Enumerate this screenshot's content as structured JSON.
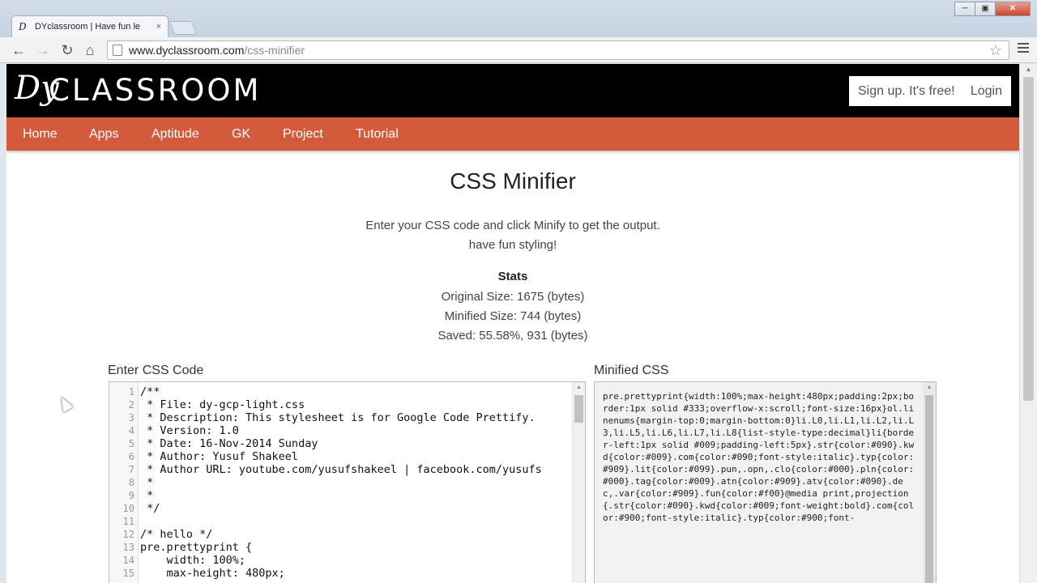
{
  "browser": {
    "tab_title": "DYclassroom | Have fun le",
    "tab_close": "×",
    "url_host": "www.dyclassroom.com",
    "url_path": "/css-minifier"
  },
  "header": {
    "logo_mark": "Dy",
    "logo_text": "CLASSROOM",
    "signup": "Sign up. It's free!",
    "login": "Login"
  },
  "nav": [
    "Home",
    "Apps",
    "Aptitude",
    "GK",
    "Project",
    "Tutorial"
  ],
  "main": {
    "title": "CSS Minifier",
    "intro_line1": "Enter your CSS code and click Minify to get the output.",
    "intro_line2": "have fun styling!",
    "stats_title": "Stats",
    "original_size": "Original Size: 1675 (bytes)",
    "minified_size": "Minified Size: 744 (bytes)",
    "saved": "Saved: 55.58%, 931 (bytes)",
    "input_label": "Enter CSS Code",
    "output_label": "Minified CSS"
  },
  "editor": {
    "line_numbers": "1\n2\n3\n4\n5\n6\n7\n8\n9\n10\n11\n12\n13\n14\n15",
    "code": "/**\n * File: dy-gcp-light.css\n * Description: This stylesheet is for Google Code Prettify.\n * Version: 1.0\n * Date: 16-Nov-2014 Sunday\n * Author: Yusuf Shakeel\n * Author URL: youtube.com/yusufshakeel | facebook.com/yusufs\n *\n *\n */\n\n/* hello */\npre.prettyprint {\n    width: 100%;\n    max-height: 480px;"
  },
  "output": {
    "minified": "pre.prettyprint{width:100%;max-height:480px;padding:2px;border:1px solid #333;overflow-x:scroll;font-size:16px}ol.linenums{margin-top:0;margin-bottom:0}li.L0,li.L1,li.L2,li.L3,li.L5,li.L6,li.L7,li.L8{list-style-type:decimal}li{border-left:1px solid #009;padding-left:5px}.str{color:#090}.kwd{color:#009}.com{color:#090;font-style:italic}.typ{color:#909}.lit{color:#099}.pun,.opn,.clo{color:#000}.pln{color:#000}.tag{color:#009}.atn{color:#909}.atv{color:#090}.dec,.var{color:#909}.fun{color:#f00}@media print,projection{.str{color:#090}.kwd{color:#009;font-weight:bold}.com{color:#900;font-style:italic}.typ{color:#900;font-"
  },
  "colors": {
    "nav_bg": "#d35b3c",
    "header_bg": "#000000"
  }
}
